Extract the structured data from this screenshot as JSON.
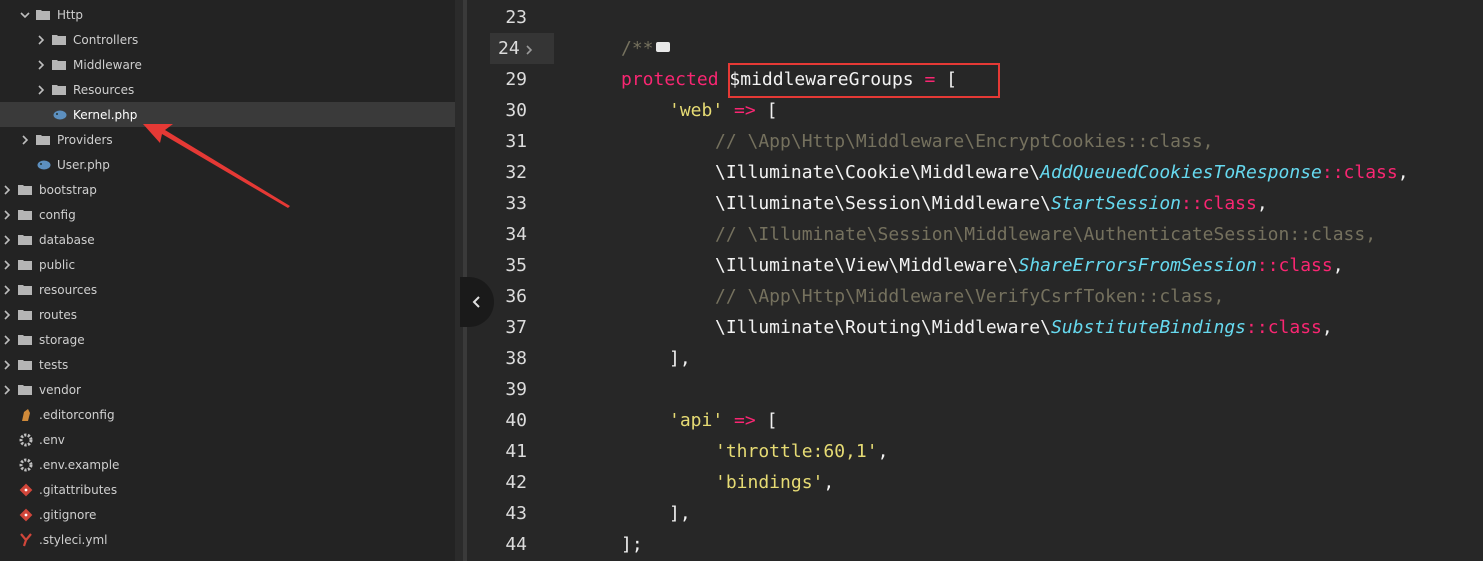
{
  "sidebar": {
    "items": [
      {
        "label": "Http",
        "type": "folder",
        "expanded": true
      },
      {
        "label": "Controllers",
        "type": "folder",
        "expanded": false
      },
      {
        "label": "Middleware",
        "type": "folder",
        "expanded": false
      },
      {
        "label": "Resources",
        "type": "folder",
        "expanded": false
      },
      {
        "label": "Kernel.php",
        "type": "php-file",
        "selected": true
      },
      {
        "label": "Providers",
        "type": "folder",
        "expanded": false
      },
      {
        "label": "User.php",
        "type": "php-file"
      },
      {
        "label": "bootstrap",
        "type": "folder",
        "expanded": false
      },
      {
        "label": "config",
        "type": "folder",
        "expanded": false
      },
      {
        "label": "database",
        "type": "folder",
        "expanded": false
      },
      {
        "label": "public",
        "type": "folder",
        "expanded": false
      },
      {
        "label": "resources",
        "type": "folder",
        "expanded": false
      },
      {
        "label": "routes",
        "type": "folder",
        "expanded": false
      },
      {
        "label": "storage",
        "type": "folder",
        "expanded": false
      },
      {
        "label": "tests",
        "type": "folder",
        "expanded": false
      },
      {
        "label": "vendor",
        "type": "folder",
        "expanded": false
      },
      {
        "label": ".editorconfig",
        "type": "editorconfig-file"
      },
      {
        "label": ".env",
        "type": "gear-file"
      },
      {
        "label": ".env.example",
        "type": "gear-file"
      },
      {
        "label": ".gitattributes",
        "type": "git-file"
      },
      {
        "label": ".gitignore",
        "type": "git-file"
      },
      {
        "label": ".styleci.yml",
        "type": "yml-file"
      }
    ]
  },
  "gutter": {
    "line_numbers": [
      "23",
      "24",
      "29",
      "30",
      "31",
      "32",
      "33",
      "34",
      "35",
      "36",
      "37",
      "38",
      "39",
      "40",
      "41",
      "42",
      "43",
      "44"
    ]
  },
  "code": {
    "l23": "",
    "l24_comment": "/**",
    "l29_kw": "protected",
    "l29_var": "$middlewareGroups",
    "l29_eq": "=",
    "l29_br": "[",
    "l30_str": "'web'",
    "l30_op": "=>",
    "l30_br": "[",
    "l31_cmt": "// \\App\\Http\\Middleware\\EncryptCookies::class,",
    "l32_ns": "\\Illuminate\\Cookie\\Middleware\\",
    "l32_cls": "AddQueuedCookiesToResponse",
    "l32_op": "::class",
    "l32_end": ",",
    "l33_ns": "\\Illuminate\\Session\\Middleware\\",
    "l33_cls": "StartSession",
    "l33_op": "::class",
    "l33_end": ",",
    "l34_cmt": "// \\Illuminate\\Session\\Middleware\\AuthenticateSession::class,",
    "l35_ns": "\\Illuminate\\View\\Middleware\\",
    "l35_cls": "ShareErrorsFromSession",
    "l35_op": "::class",
    "l35_end": ",",
    "l36_cmt": "// \\App\\Http\\Middleware\\VerifyCsrfToken::class,",
    "l37_ns": "\\Illuminate\\Routing\\Middleware\\",
    "l37_cls": "SubstituteBindings",
    "l37_op": "::class",
    "l37_end": ",",
    "l38": "],",
    "l39": "",
    "l40_str": "'api'",
    "l40_op": "=>",
    "l40_br": "[",
    "l41_str": "'throttle:60,1'",
    "l41_end": ",",
    "l42_str": "'bindings'",
    "l42_end": ",",
    "l43": "],",
    "l44": "];"
  },
  "colors": {
    "keyword": "#f92672",
    "string": "#e6db74",
    "comment": "#75715e",
    "class": "#66d9ef",
    "highlight_box": "#e53935"
  }
}
